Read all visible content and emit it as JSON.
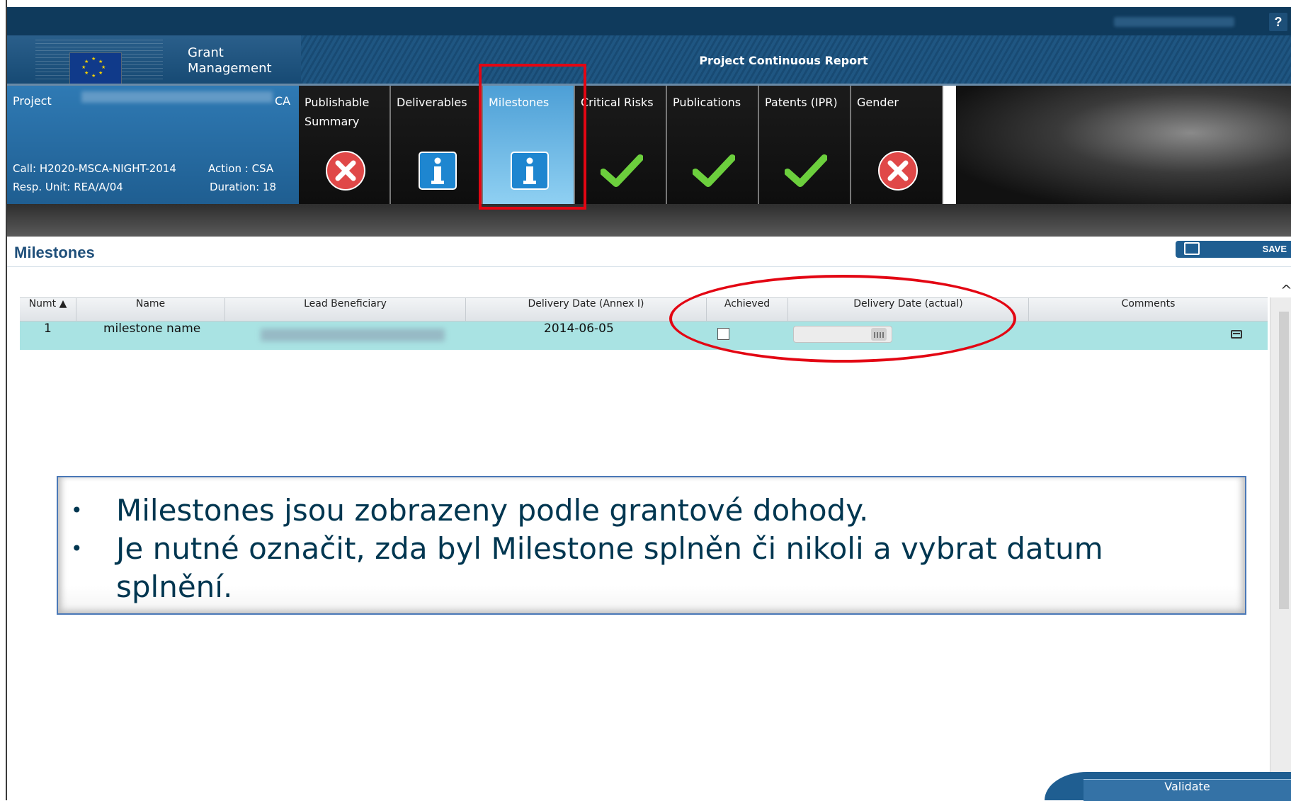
{
  "app": {
    "logo_line1": "Grant",
    "logo_line2": "Management",
    "report_title": "Project Continuous Report",
    "help_label": "?"
  },
  "project": {
    "project_label": "Project",
    "project_suffix": "CA",
    "call": "Call: H2020-MSCA-NIGHT-2014",
    "action": "Action : CSA",
    "resp_unit": "Resp. Unit: REA/A/04",
    "duration": "Duration: 18"
  },
  "tabs": [
    {
      "label": "Publishable Summary",
      "status": "error"
    },
    {
      "label": "Deliverables",
      "status": "info"
    },
    {
      "label": "Milestones",
      "status": "info",
      "active": true
    },
    {
      "label": "Critical Risks",
      "status": "ok"
    },
    {
      "label": "Publications",
      "status": "ok"
    },
    {
      "label": "Patents (IPR)",
      "status": "ok"
    },
    {
      "label": "Gender",
      "status": "error"
    }
  ],
  "section": {
    "title": "Milestones",
    "save_label": "SAVE"
  },
  "grid": {
    "headers": [
      "Numt ▲",
      "Name",
      "Lead Beneficiary",
      "Delivery Date (Annex I)",
      "Achieved",
      "Delivery Date (actual)",
      "Comments"
    ],
    "rows": [
      {
        "num": "1",
        "name": "milestone name",
        "lead": "",
        "annex_date": "2014-06-05",
        "achieved": false,
        "actual_date": ""
      }
    ]
  },
  "callout": {
    "bullet1": "Milestones jsou zobrazeny podle grantové dohody.",
    "bullet2": "Je nutné označit, zda byl Milestone splněn či nikoli a vybrat datum splnění."
  },
  "footer": {
    "validate_label": "Validate"
  },
  "colors": {
    "highlight": "#e30613",
    "accent": "#1f5e91",
    "row_selected": "#a9e3e3"
  }
}
